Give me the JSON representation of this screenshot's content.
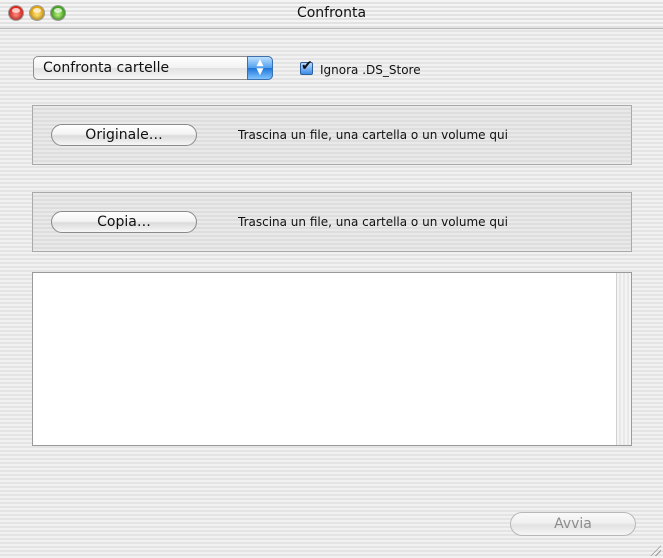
{
  "window": {
    "title": "Confronta"
  },
  "mode_popup": {
    "selected": "Confronta cartelle",
    "arrows": "▲\n▼"
  },
  "ignore_ds_store": {
    "label": "Ignora .DS_Store",
    "checked": true
  },
  "original": {
    "button_label": "Originale…",
    "hint": "Trascina un file, una cartella o un volume qui"
  },
  "copy": {
    "button_label": "Copia…",
    "hint": "Trascina un file, una cartella o un volume qui"
  },
  "results": {
    "items": []
  },
  "footer": {
    "start_label": "Avvia",
    "start_enabled": false
  }
}
